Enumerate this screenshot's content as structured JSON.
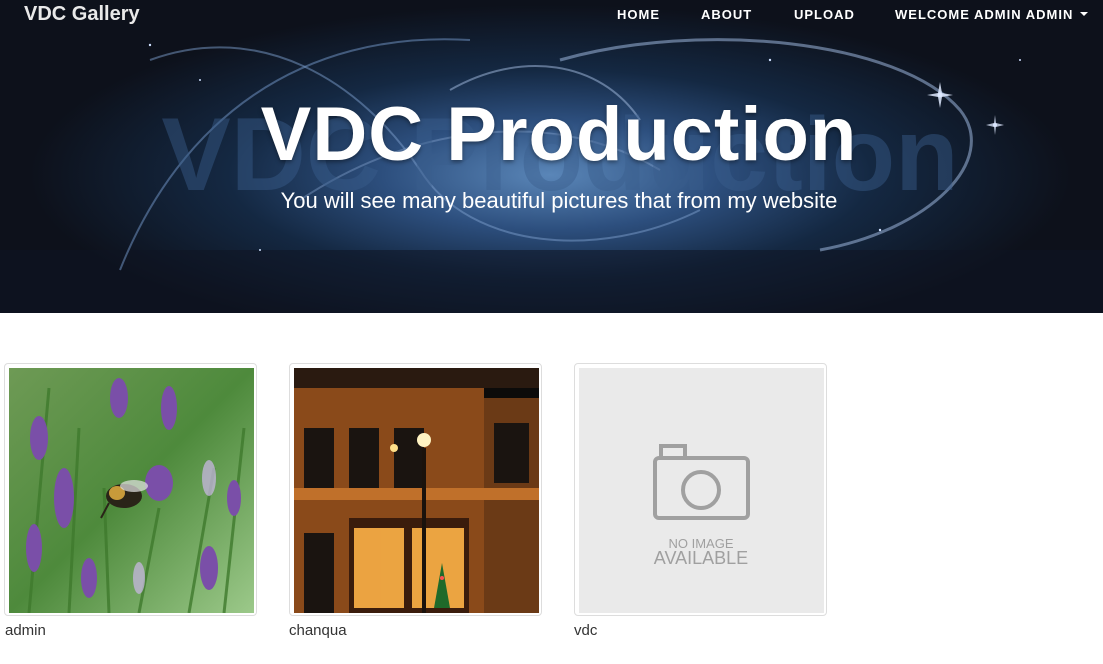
{
  "navbar": {
    "brand": "VDC Gallery",
    "items": [
      {
        "label": "HOME"
      },
      {
        "label": "ABOUT"
      },
      {
        "label": "UPLOAD"
      },
      {
        "label": "WELCOME ADMIN ADMIN",
        "icon": "caret-down-icon"
      }
    ]
  },
  "hero": {
    "title": "VDC Production",
    "subtitle": "You will see many beautiful pictures that from my website"
  },
  "gallery": {
    "albums": [
      {
        "name": "admin",
        "thumbnail": "bee-on-lavender-photo"
      },
      {
        "name": "chanqua",
        "thumbnail": "night-storefront-photo"
      },
      {
        "name": "vdc",
        "thumbnail": "no-image-placeholder",
        "placeholder_line1": "NO IMAGE",
        "placeholder_line2": "AVAILABLE"
      }
    ]
  },
  "colors": {
    "hero_dark": "#0d111b",
    "hero_glow": "#5a86b8",
    "placeholder_bg": "#eaeaea",
    "placeholder_fg": "#a0a0a0",
    "card_border": "#dddddd"
  }
}
